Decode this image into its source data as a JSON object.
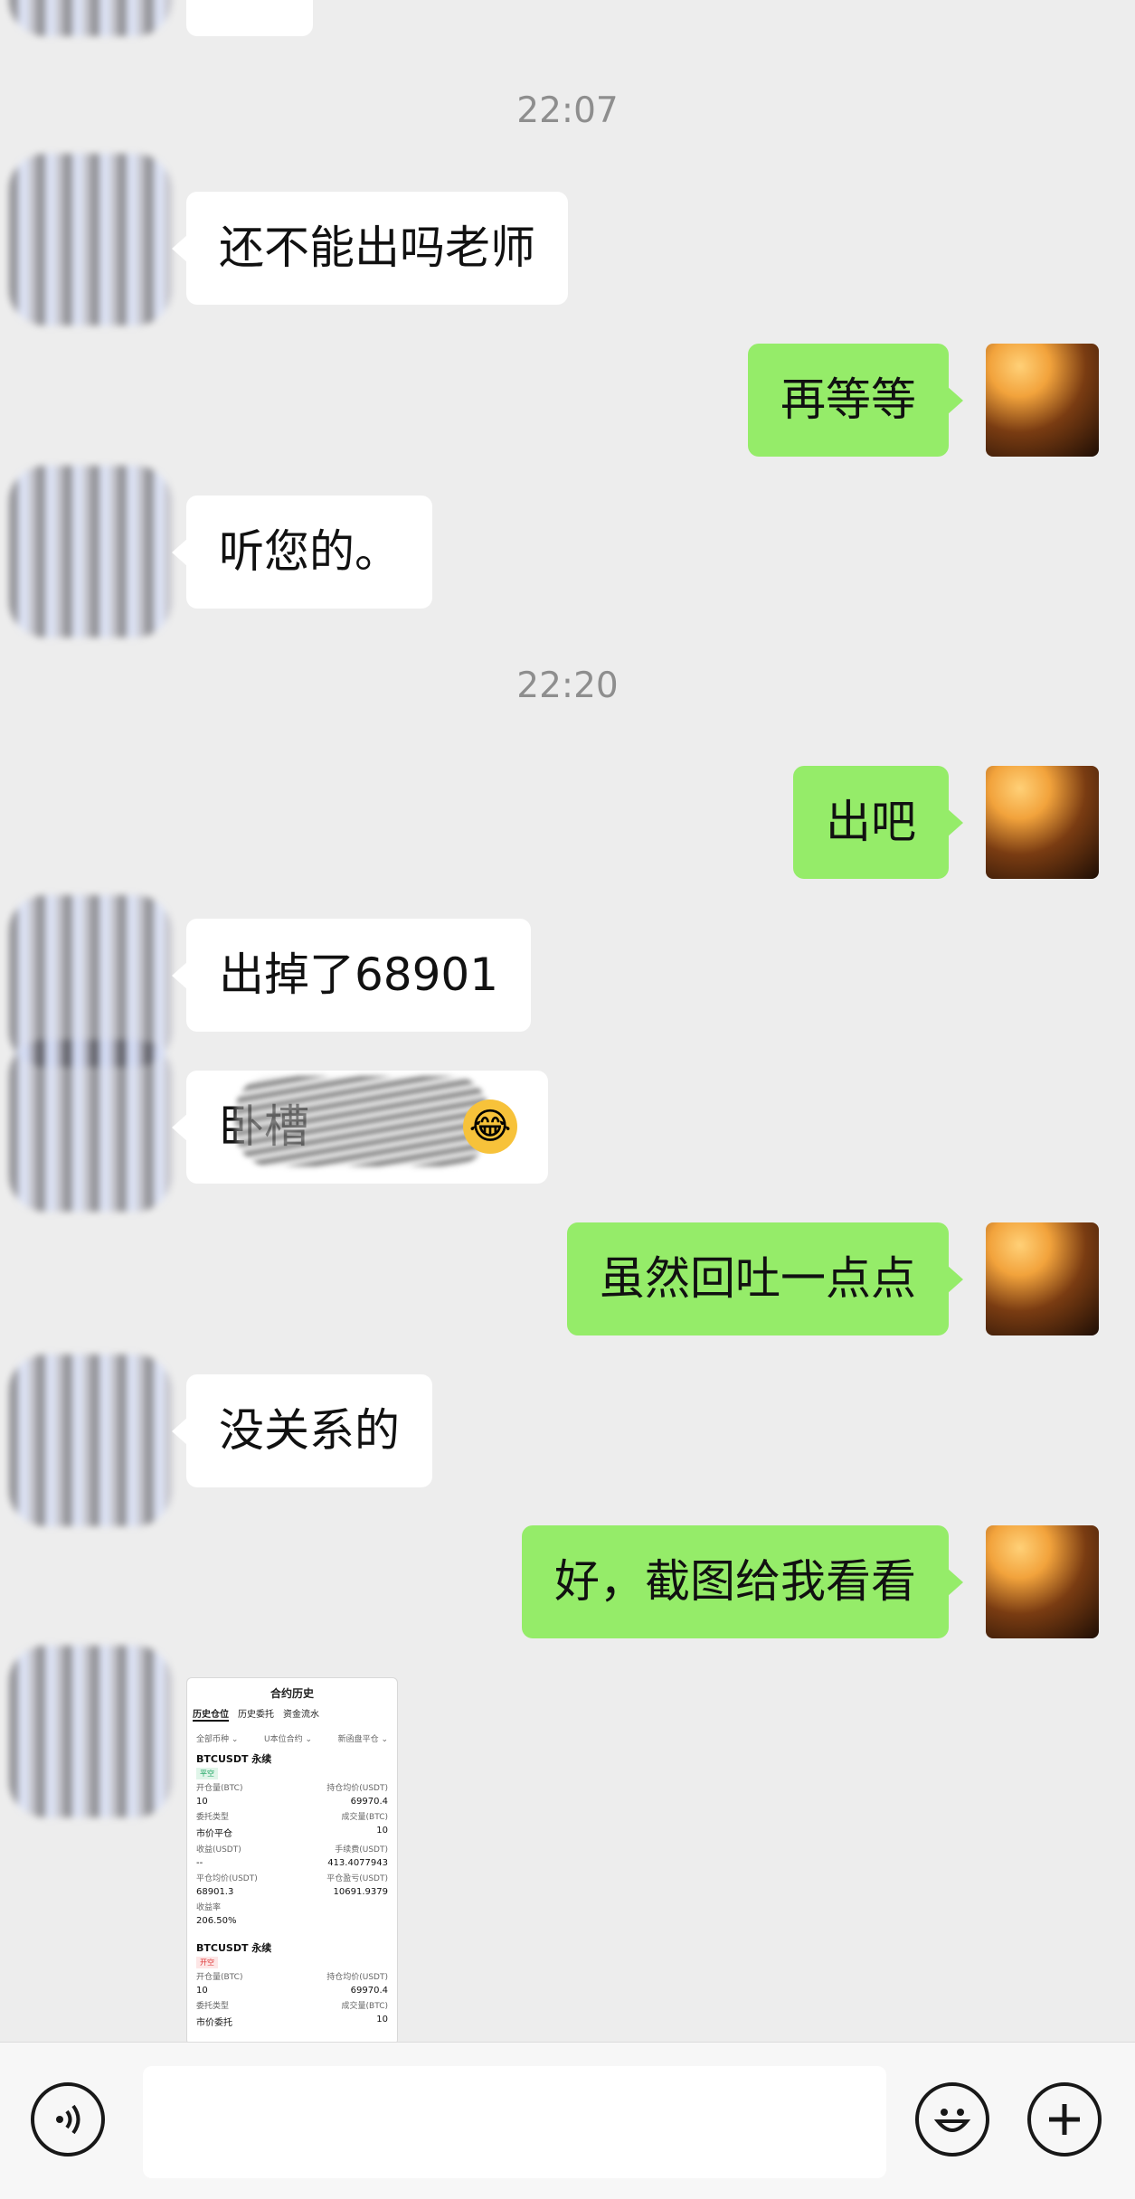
{
  "chat": {
    "timestamps": [
      "22:07",
      "22:20"
    ],
    "messages": [
      {
        "text": "还不能出吗老师"
      },
      {
        "text": "再等等"
      },
      {
        "text": "听您的。"
      },
      {
        "text": "出吧"
      },
      {
        "text": "出掉了68901"
      },
      {
        "text": "卧槽"
      },
      {
        "text": "虽然回吐一点点"
      },
      {
        "text": "没关系的"
      },
      {
        "text": "好，截图给我看看"
      }
    ],
    "emoji": "😂"
  },
  "screenshot": {
    "header": "合约历史",
    "tabs": [
      "历史仓位",
      "历史委托",
      "资金流水"
    ],
    "filters": [
      "全部币种 ⌄",
      "U本位合约 ⌄",
      "新函盘平仓 ⌄"
    ],
    "entries": [
      {
        "symbol": "BTCUSDT 永续",
        "tag": "平空",
        "rows": [
          [
            "开仓量(BTC)",
            "持仓均价(USDT)"
          ],
          [
            "10",
            "69970.4"
          ],
          [
            "委托类型",
            "成交量(BTC)"
          ],
          [
            "市价平仓",
            "10"
          ],
          [
            "收益(USDT)",
            "手续费(USDT)"
          ],
          [
            "--",
            "413.4077943"
          ],
          [
            "平仓均价(USDT)",
            "平仓盈亏(USDT)"
          ],
          [
            "68901.3",
            "10691.9379"
          ],
          [
            "收益率",
            ""
          ],
          [
            "206.50%",
            ""
          ]
        ]
      },
      {
        "symbol": "BTCUSDT 永续",
        "tag": "开空",
        "rows": [
          [
            "开仓量(BTC)",
            "持仓均价(USDT)"
          ],
          [
            "10",
            "69970.4"
          ],
          [
            "委托类型",
            "成交量(BTC)"
          ],
          [
            "市价委托",
            "10"
          ]
        ]
      }
    ]
  },
  "input_bar": {
    "voice_icon": "voice-icon",
    "emoji_icon": "emoji-icon",
    "plus_icon": "plus-icon"
  }
}
